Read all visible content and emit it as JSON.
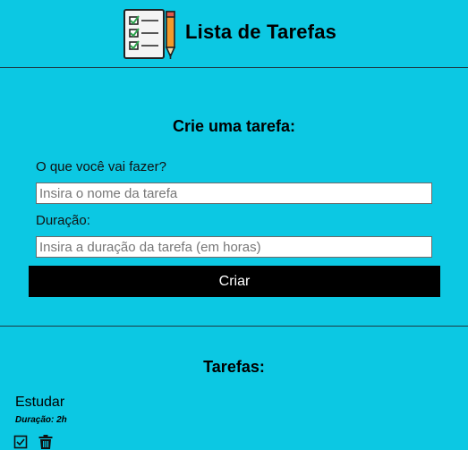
{
  "header": {
    "title": "Lista de Tarefas",
    "logo_icon": "checklist-pencil-icon"
  },
  "form": {
    "title": "Crie uma tarefa:",
    "task_label": "O que você vai fazer?",
    "task_placeholder": "Insira o nome da tarefa",
    "task_value": "",
    "duration_label": "Duração:",
    "duration_placeholder": "Insira a duração da tarefa (em horas)",
    "duration_value": "",
    "submit_label": "Criar"
  },
  "tasks": {
    "title": "Tarefas:",
    "items": [
      {
        "name": "Estudar",
        "duration": "Duração: 2h",
        "actions": [
          "check-icon",
          "trash-icon"
        ]
      }
    ]
  },
  "colors": {
    "background": "#0cc8e3",
    "button": "#000000",
    "button_text": "#ffffff"
  }
}
